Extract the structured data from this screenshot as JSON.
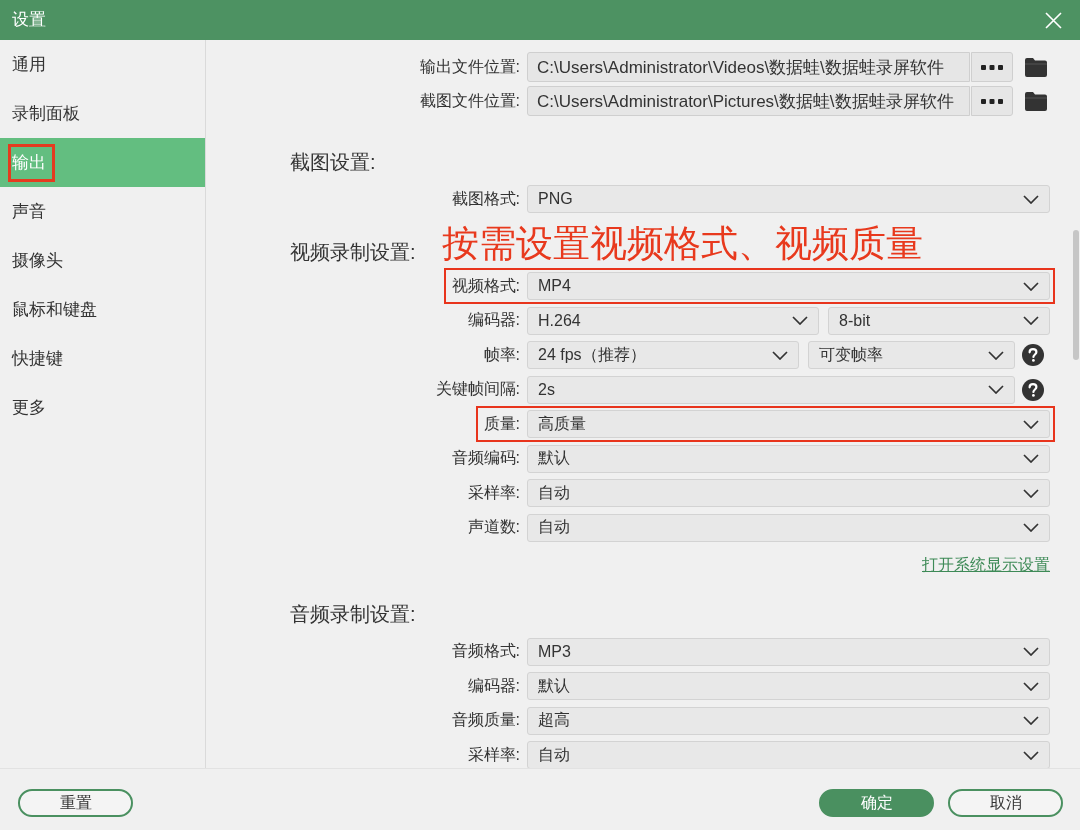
{
  "window": {
    "title": "设置"
  },
  "sidebar": {
    "items": [
      {
        "label": "通用",
        "selected": false,
        "highlighted": false
      },
      {
        "label": "录制面板",
        "selected": false,
        "highlighted": false
      },
      {
        "label": "输出",
        "selected": true,
        "highlighted": true
      },
      {
        "label": "声音",
        "selected": false,
        "highlighted": false
      },
      {
        "label": "摄像头",
        "selected": false,
        "highlighted": false
      },
      {
        "label": "鼠标和键盘",
        "selected": false,
        "highlighted": false
      },
      {
        "label": "快捷键",
        "selected": false,
        "highlighted": false
      },
      {
        "label": "更多",
        "selected": false,
        "highlighted": false
      }
    ]
  },
  "locations": [
    {
      "label": "输出文件位置:",
      "value": "C:\\Users\\Administrator\\Videos\\数据蛙\\数据蛙录屏软件"
    },
    {
      "label": "截图文件位置:",
      "value": "C:\\Users\\Administrator\\Pictures\\数据蛙\\数据蛙录屏软件"
    }
  ],
  "sections": [
    {
      "title": "截图设置:",
      "rows": [
        {
          "label": "截图格式:",
          "highlighted": false,
          "help": false,
          "fields": [
            {
              "value": "PNG"
            }
          ]
        }
      ]
    },
    {
      "title": "视频录制设置:",
      "annotation": "按需设置视频格式、视频质量",
      "rows": [
        {
          "label": "视频格式:",
          "highlighted": true,
          "help": false,
          "fields": [
            {
              "value": "MP4"
            }
          ]
        },
        {
          "label": "编码器:",
          "highlighted": false,
          "help": false,
          "fields": [
            {
              "value": "H.264"
            },
            {
              "value": "8-bit"
            }
          ]
        },
        {
          "label": "帧率:",
          "highlighted": false,
          "help": true,
          "fields": [
            {
              "value": "24 fps（推荐）"
            },
            {
              "value": "可变帧率"
            }
          ]
        },
        {
          "label": "关键帧间隔:",
          "highlighted": false,
          "help": true,
          "fields": [
            {
              "value": "2s"
            }
          ]
        },
        {
          "label": "质量:",
          "highlighted": true,
          "help": false,
          "fields": [
            {
              "value": "高质量"
            }
          ]
        },
        {
          "label": "音频编码:",
          "highlighted": false,
          "help": false,
          "fields": [
            {
              "value": "默认"
            }
          ]
        },
        {
          "label": "采样率:",
          "highlighted": false,
          "help": false,
          "fields": [
            {
              "value": "自动"
            }
          ]
        },
        {
          "label": "声道数:",
          "highlighted": false,
          "help": false,
          "fields": [
            {
              "value": "自动"
            }
          ]
        }
      ],
      "link": "打开系统显示设置"
    },
    {
      "title": "音频录制设置:",
      "rows": [
        {
          "label": "音频格式:",
          "highlighted": false,
          "help": false,
          "fields": [
            {
              "value": "MP3"
            }
          ]
        },
        {
          "label": "编码器:",
          "highlighted": false,
          "help": false,
          "fields": [
            {
              "value": "默认"
            }
          ]
        },
        {
          "label": "音频质量:",
          "highlighted": false,
          "help": false,
          "fields": [
            {
              "value": "超高"
            }
          ]
        },
        {
          "label": "采样率:",
          "highlighted": false,
          "help": false,
          "fields": [
            {
              "value": "自动"
            }
          ]
        }
      ]
    }
  ],
  "footer": {
    "buttons": [
      {
        "label": "重置",
        "kind": "secondary"
      },
      {
        "label": "确定",
        "kind": "primary"
      },
      {
        "label": "取消",
        "kind": "secondary"
      }
    ]
  }
}
